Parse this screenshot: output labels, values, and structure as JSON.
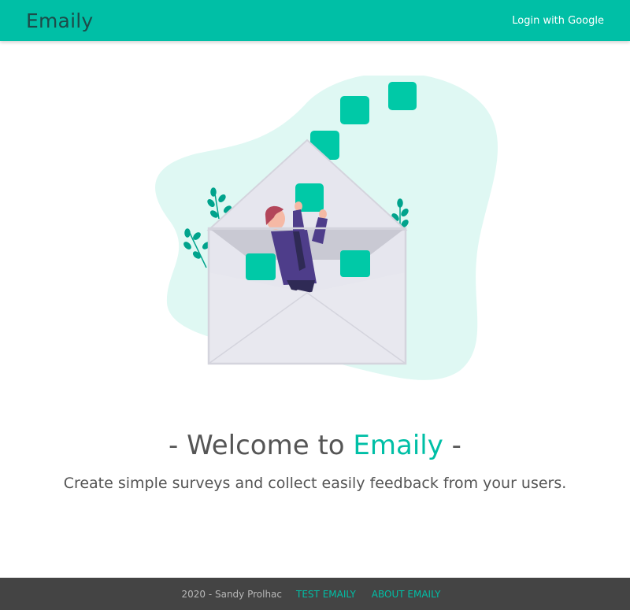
{
  "navbar": {
    "brand": "Emaily",
    "login_label": "Login with Google"
  },
  "hero": {
    "welcome_prefix": "- Welcome to ",
    "welcome_accent": "Emaily",
    "welcome_suffix": " -",
    "tagline": "Create simple surveys and collect easily feedback from your users."
  },
  "footer": {
    "copyright": "2020 - Sandy Prolhac",
    "links": [
      "TEST EMAILY",
      "ABOUT EMAILY"
    ]
  },
  "colors": {
    "accent": "#00bfa6",
    "brand_text": "#1d4b49",
    "footer_bg": "#444444",
    "blob": "#dff8f3"
  },
  "illustration": {
    "name": "envelope-with-person-illustration"
  }
}
